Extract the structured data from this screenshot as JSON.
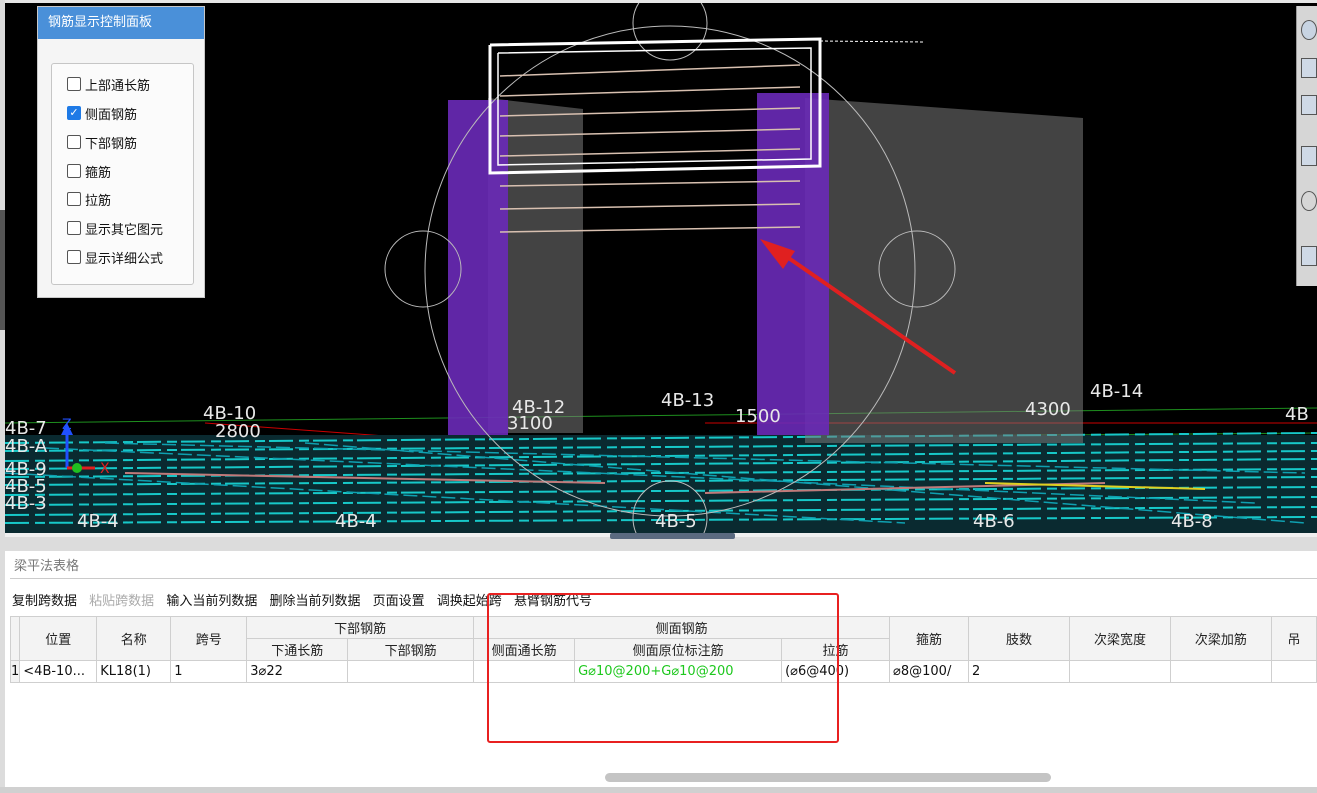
{
  "control_panel": {
    "title": "钢筋显示控制面板",
    "options": [
      {
        "label": "上部通长筋",
        "checked": false
      },
      {
        "label": "侧面钢筋",
        "checked": true
      },
      {
        "label": "下部钢筋",
        "checked": false
      },
      {
        "label": "箍筋",
        "checked": false
      },
      {
        "label": "拉筋",
        "checked": false
      },
      {
        "label": "显示其它图元",
        "checked": false
      },
      {
        "label": "显示详细公式",
        "checked": false
      }
    ]
  },
  "viewport": {
    "axis_labels": [
      "4B-7",
      "4B-A",
      "4B-9",
      "4B-5",
      "4B-3",
      "4B-10",
      "4B-12",
      "4B-13",
      "4B-14",
      "4B-4",
      "4B-4",
      "4B-5",
      "4B-6",
      "4B-8",
      "4B"
    ],
    "dimensions": [
      "2800",
      "3100",
      "1500",
      "4300"
    ],
    "axis_letters": {
      "x": "X",
      "z": "Z"
    }
  },
  "table_panel": {
    "title": "梁平法表格",
    "toolbar": [
      {
        "label": "复制跨数据",
        "enabled": true
      },
      {
        "label": "粘贴跨数据",
        "enabled": false
      },
      {
        "label": "输入当前列数据",
        "enabled": true
      },
      {
        "label": "删除当前列数据",
        "enabled": true
      },
      {
        "label": "页面设置",
        "enabled": true
      },
      {
        "label": "调换起始跨",
        "enabled": true
      },
      {
        "label": "悬臂钢筋代号",
        "enabled": true
      }
    ],
    "headers": {
      "position": "位置",
      "name": "名称",
      "span": "跨号",
      "bottom_group": "下部钢筋",
      "bottom_through": "下通长筋",
      "bottom_rebar": "下部钢筋",
      "side_group": "侧面钢筋",
      "side_through": "侧面通长筋",
      "side_original": "侧面原位标注筋",
      "tie": "拉筋",
      "stirrup": "箍筋",
      "legs": "肢数",
      "sec_width": "次梁宽度",
      "sec_add": "次梁加筋",
      "hang": "吊"
    },
    "rows": [
      {
        "index": "1",
        "position": "<4B-10...",
        "name": "KL18(1)",
        "span": "1",
        "bottom_through": "3⌀22",
        "bottom_rebar": "",
        "side_through": "",
        "side_original": "G⌀10@200+G⌀10@200",
        "tie": "(⌀6@400)",
        "stirrup": "⌀8@100/",
        "legs": "2",
        "sec_width": "",
        "sec_add": "",
        "hang": ""
      }
    ]
  },
  "colors": {
    "accent": "#4a90d9",
    "highlight_box": "#e82020",
    "side_rebar_text": "#1ec81e",
    "column": "#7a2ec8"
  }
}
